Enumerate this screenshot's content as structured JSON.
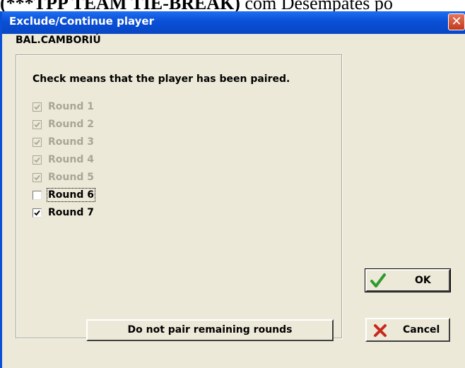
{
  "background": {
    "bold_text": "(***TPP TEAM TIE-BREAK)",
    "text": " com Desempates po"
  },
  "dialog": {
    "title": "Exclude/Continue player",
    "close_glyph": "✕",
    "player_name": "BAL.CAMBORIÚ",
    "instruction": "Check means that the player has been paired.",
    "rounds": [
      {
        "label": "Round 1",
        "checked": true,
        "enabled": false
      },
      {
        "label": "Round 2",
        "checked": true,
        "enabled": false
      },
      {
        "label": "Round 3",
        "checked": true,
        "enabled": false
      },
      {
        "label": "Round 4",
        "checked": true,
        "enabled": false
      },
      {
        "label": "Round 5",
        "checked": true,
        "enabled": false
      },
      {
        "label": "Round 6",
        "checked": false,
        "enabled": true,
        "focused": true
      },
      {
        "label": "Round 7",
        "checked": true,
        "enabled": true
      }
    ],
    "buttons": {
      "do_not_pair": "Do not pair remaining rounds",
      "ok": "OK",
      "cancel": "Cancel"
    },
    "icons": {
      "ok": "checkmark-icon",
      "cancel": "x-icon"
    },
    "colors": {
      "title_bar": "#0a4fd6",
      "ok_icon": "#2e9a2e",
      "cancel_icon": "#c8281e",
      "disabled_text": "#a8a696"
    }
  }
}
